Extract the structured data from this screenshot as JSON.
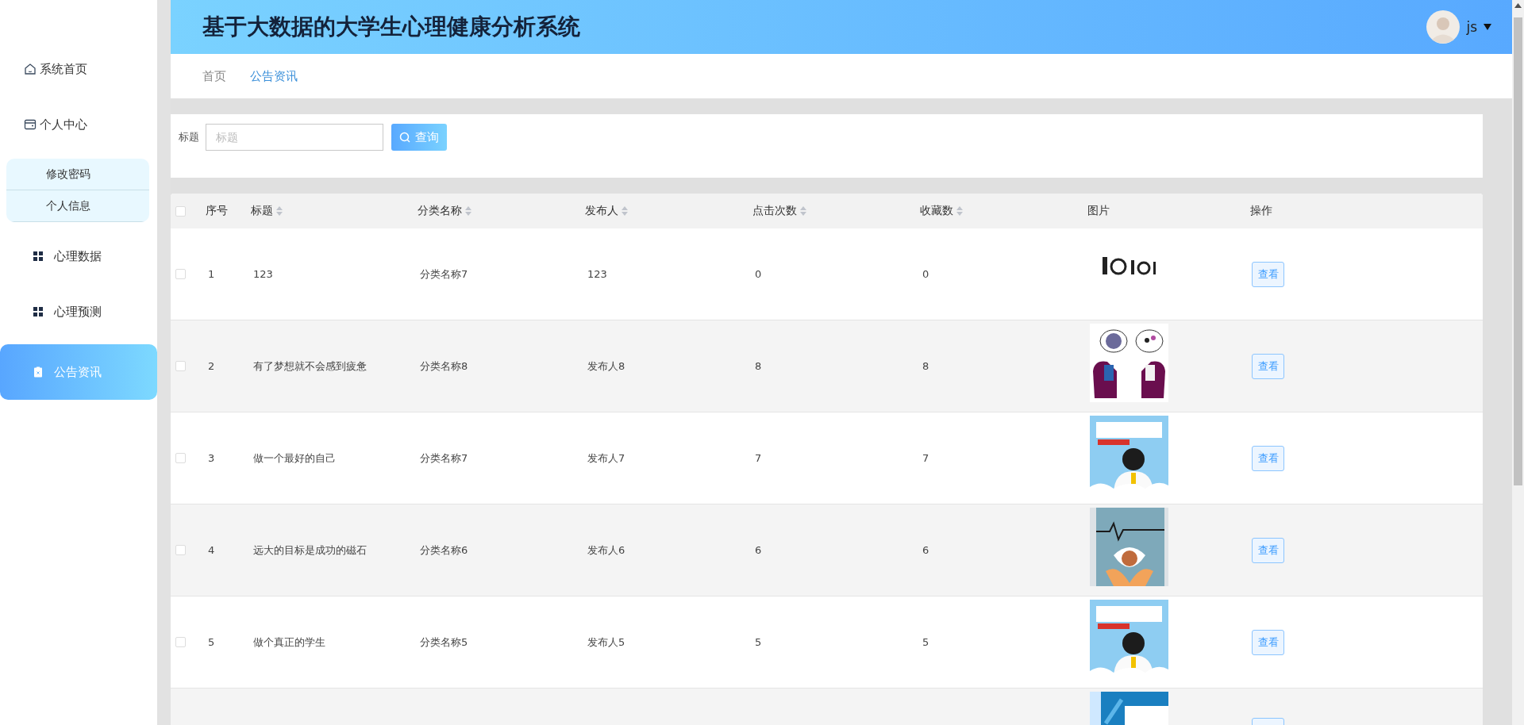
{
  "header": {
    "title": "基于大数据的大学生心理健康分析系统",
    "user": {
      "name": "js"
    }
  },
  "sidebar": {
    "items": [
      {
        "label": "系统首页",
        "kind": "home",
        "selected": false
      },
      {
        "label": "个人中心",
        "kind": "wallet",
        "selected": false,
        "expanded": true,
        "children": [
          {
            "label": "修改密码",
            "selected": false
          },
          {
            "label": "个人信息",
            "selected": false
          }
        ]
      },
      {
        "label": "心理数据",
        "kind": "grid",
        "selected": false
      },
      {
        "label": "心理预测",
        "kind": "grid",
        "selected": false
      },
      {
        "label": "公告资讯",
        "kind": "clipboard",
        "selected": true
      }
    ]
  },
  "breadcrumb": [
    {
      "label": "首页",
      "selected": false
    },
    {
      "label": "公告资讯",
      "selected": true
    }
  ],
  "search": {
    "label": "标题",
    "placeholder": "标题",
    "button": "查询"
  },
  "table": {
    "select_all": {
      "checked": false
    },
    "columns": [
      {
        "label": "序号",
        "kind": "plain"
      },
      {
        "label": "标题",
        "kind": "sortable"
      },
      {
        "label": "分类名称",
        "kind": "sortable"
      },
      {
        "label": "发布人",
        "kind": "sortable"
      },
      {
        "label": "点击次数",
        "kind": "sortable"
      },
      {
        "label": "收藏数",
        "kind": "sortable"
      },
      {
        "label": "图片",
        "kind": "plain"
      },
      {
        "label": "操作",
        "kind": "plain"
      }
    ],
    "rows": [
      {
        "selected": false,
        "cells": [
          "1",
          "123",
          "分类名称7",
          "123",
          "0",
          "0"
        ],
        "action": "查看"
      },
      {
        "selected": false,
        "cells": [
          "2",
          "有了梦想就不会感到疲惫",
          "分类名称8",
          "发布人8",
          "8",
          "8"
        ],
        "action": "查看"
      },
      {
        "selected": false,
        "cells": [
          "3",
          "做一个最好的自己",
          "分类名称7",
          "发布人7",
          "7",
          "7"
        ],
        "action": "查看"
      },
      {
        "selected": false,
        "cells": [
          "4",
          "远大的目标是成功的磁石",
          "分类名称6",
          "发布人6",
          "6",
          "6"
        ],
        "action": "查看"
      },
      {
        "selected": false,
        "cells": [
          "5",
          "做个真正的学生",
          "分类名称5",
          "发布人5",
          "5",
          "5"
        ],
        "action": "查看"
      },
      {
        "kind": "picture"
      }
    ]
  }
}
